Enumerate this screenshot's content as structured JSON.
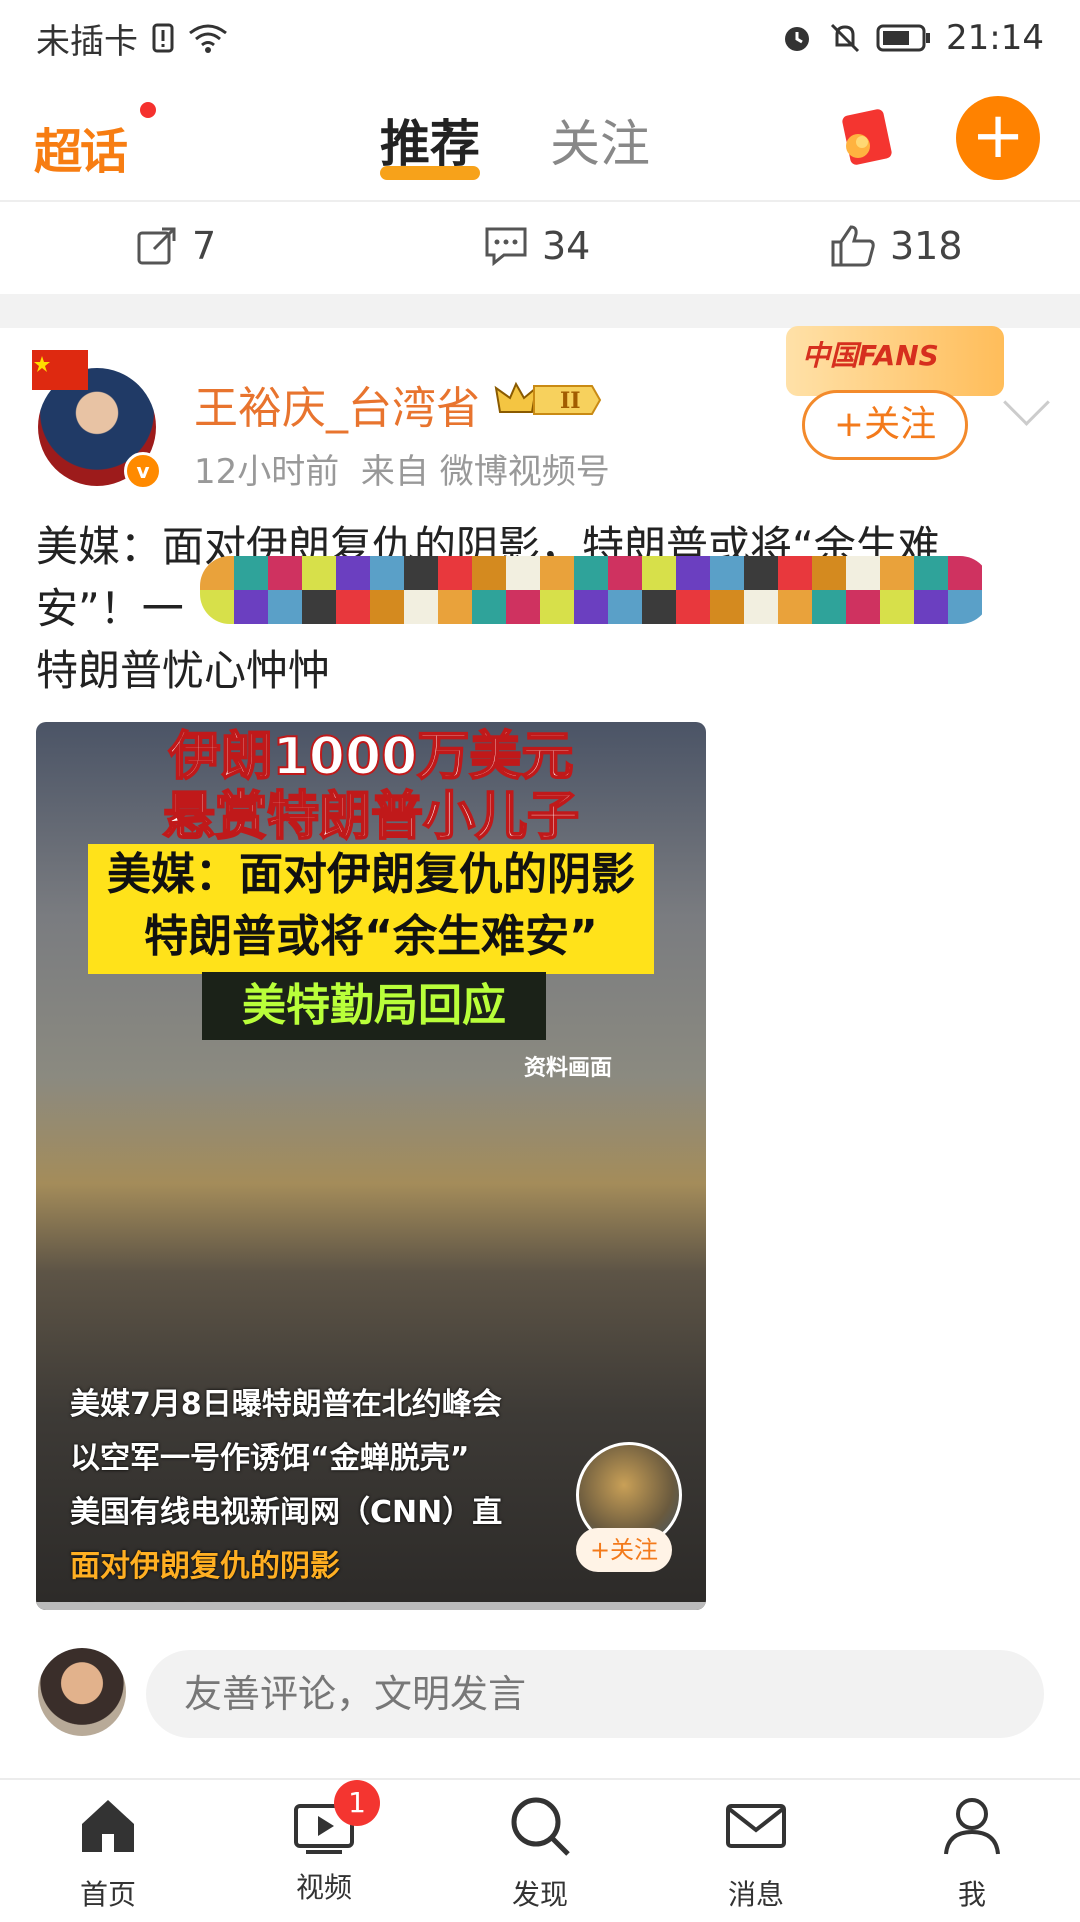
{
  "status_bar": {
    "carrier": "未插卡",
    "time": "21:14"
  },
  "top_nav": {
    "logo": "超话",
    "tabs": [
      {
        "label": "推荐",
        "active": true
      },
      {
        "label": "关注",
        "active": false
      }
    ],
    "add_button": "+"
  },
  "post_actions": {
    "repost_count": "7",
    "comment_count": "34",
    "like_count": "318"
  },
  "post": {
    "username": "王裕庆_台湾省",
    "level_badge": "II",
    "time": "12小时前",
    "source": "来自 微博视频号",
    "fans_badge": "中国FANS",
    "follow_label": "+关注",
    "text_line1": "美媒：面对伊朗复仇的阴影，特朗普或将“余生难",
    "text_line2": "安”！一",
    "text_line3": "特朗普忧心忡忡"
  },
  "media": {
    "title1": "伊朗1000万美元",
    "title2": "悬赏特朗普小儿子",
    "yellow1": "美媒：面对伊朗复仇的阴影",
    "yellow2": "特朗普或将“余生难安”",
    "green": "美特勤局回应",
    "ref": "资料画面",
    "sub1": "美媒7月8日曝特朗普在北约峰会",
    "sub2": "以空军一号作诱饵“金蝉脱壳”",
    "sub3": "美国有线电视新闻网（CNN）直",
    "sub4": "面对伊朗复仇的阴影",
    "sub5": "特朗普或将“余生难安”",
    "follow": "+关注"
  },
  "comment_box": {
    "placeholder": "友善评论，文明发言"
  },
  "bottom_nav": {
    "items": [
      {
        "label": "首页",
        "icon": "home-icon"
      },
      {
        "label": "视频",
        "icon": "video-icon",
        "badge": "1"
      },
      {
        "label": "发现",
        "icon": "search-icon"
      },
      {
        "label": "消息",
        "icon": "mail-icon"
      },
      {
        "label": "我",
        "icon": "profile-icon"
      }
    ]
  },
  "colors": {
    "accent": "#ff8200",
    "username": "#e8742e",
    "badge": "#f43530"
  }
}
